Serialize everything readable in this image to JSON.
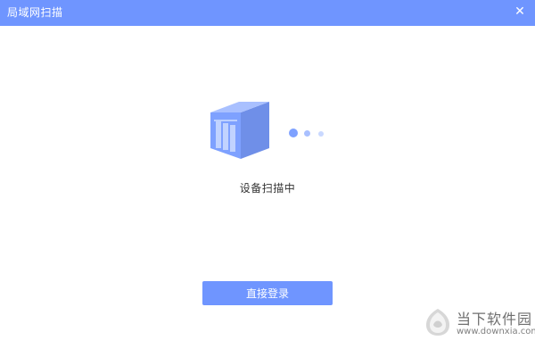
{
  "window": {
    "title": "局域网扫描",
    "close_icon": "close-icon",
    "accent_color": "#6f95ff"
  },
  "content": {
    "status_text": "设备扫描中",
    "scan_icon": "server-box-icon",
    "progress_dots": 3
  },
  "actions": {
    "direct_login_label": "直接登录"
  },
  "watermark": {
    "name": "当下软件园",
    "url": "www.downxia.com",
    "logo_icon": "watermark-logo-icon"
  }
}
